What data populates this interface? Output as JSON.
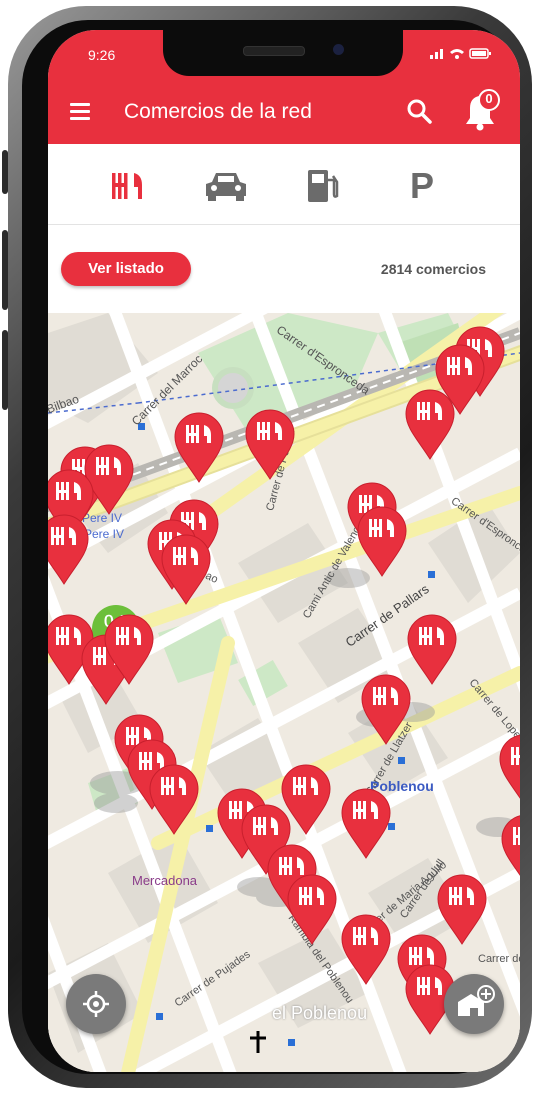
{
  "statusbar": {
    "time": "9:26"
  },
  "header": {
    "title": "Comercios de la red",
    "notifications_count": "0"
  },
  "tabs": [
    {
      "name": "restaurantes",
      "icon": "fork-knife-icon",
      "active": true
    },
    {
      "name": "coches",
      "icon": "car-icon",
      "active": false
    },
    {
      "name": "gasolineras",
      "icon": "fuel-icon",
      "active": false
    },
    {
      "name": "parking",
      "icon": "parking-icon",
      "label": "P",
      "active": false
    }
  ],
  "list": {
    "button_label": "Ver listado",
    "count_text": "2814 comercios"
  },
  "map": {
    "street_labels": [
      "Carrer del Marroc",
      "Carrer d'Espronceda",
      "Bilbao",
      "Pere IV",
      "Pere IV",
      "Carrer de Pallars",
      "Carrer de Llatzer",
      "Cami Antic de Valencia",
      "Carrer de Pere IV",
      "Carrer de Maria Aguilo",
      "Carrer de Llull",
      "Carrer de Pujades",
      "Rambla del Poblenou",
      "Carrer de Lope",
      "Carrer d'Espronceda",
      "Carrer de Venecuela",
      "Bilbao"
    ],
    "place_labels": [
      "Poblenou",
      "Mercadona",
      "el Poblenou"
    ],
    "discount_marker": "%",
    "colors": {
      "brand_red": "#e8303e",
      "discount_green": "#6cbf3a",
      "fab_gray": "#7a7a7a"
    }
  },
  "buttons": {
    "locate_icon": "target-icon",
    "add_icon": "add-store-icon"
  }
}
